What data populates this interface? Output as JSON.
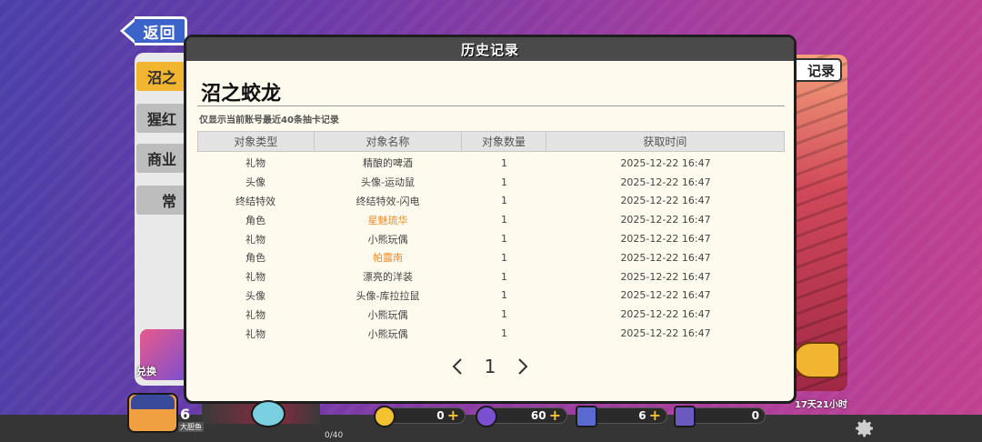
{
  "back_button": {
    "label": "返回"
  },
  "left_tabs": [
    {
      "label": "沼之",
      "active": true
    },
    {
      "label": "猩红",
      "active": false
    },
    {
      "label": "商业",
      "active": false
    },
    {
      "label": "常",
      "active": false
    }
  ],
  "left_promo": {
    "label": "兑换"
  },
  "right_panel": {
    "tag": "记录",
    "timer": "17天21小时"
  },
  "modal": {
    "header": "历史记录",
    "title": "沼之蛟龙",
    "note": "仅显示当前账号最近40条抽卡记录",
    "columns": [
      "对象类型",
      "对象名称",
      "对象数量",
      "获取时间"
    ],
    "rows": [
      {
        "type": "礼物",
        "name": "精酿的啤酒",
        "qty": "1",
        "time": "2025-12-22 16:47",
        "highlight": false
      },
      {
        "type": "头像",
        "name": "头像-运动鼠",
        "qty": "1",
        "time": "2025-12-22 16:47",
        "highlight": false
      },
      {
        "type": "终结特效",
        "name": "终结特效-闪电",
        "qty": "1",
        "time": "2025-12-22 16:47",
        "highlight": false
      },
      {
        "type": "角色",
        "name": "星魅琉华",
        "qty": "1",
        "time": "2025-12-22 16:47",
        "highlight": true
      },
      {
        "type": "礼物",
        "name": "小熊玩偶",
        "qty": "1",
        "time": "2025-12-22 16:47",
        "highlight": false
      },
      {
        "type": "角色",
        "name": "帕露南",
        "qty": "1",
        "time": "2025-12-22 16:47",
        "highlight": true
      },
      {
        "type": "礼物",
        "name": "漂亮的洋装",
        "qty": "1",
        "time": "2025-12-22 16:47",
        "highlight": false
      },
      {
        "type": "头像",
        "name": "头像-库拉拉鼠",
        "qty": "1",
        "time": "2025-12-22 16:47",
        "highlight": false
      },
      {
        "type": "礼物",
        "name": "小熊玩偶",
        "qty": "1",
        "time": "2025-12-22 16:47",
        "highlight": false
      },
      {
        "type": "礼物",
        "name": "小熊玩偶",
        "qty": "1",
        "time": "2025-12-22 16:47",
        "highlight": false
      }
    ],
    "pager": {
      "page": "1"
    },
    "highlight_color": "#f28c28"
  },
  "bottom_bar": {
    "level": "6",
    "level_label": "大胆鱼",
    "progress": "0/40",
    "resources": [
      {
        "name": "gold-coin",
        "value": "0",
        "color": "#f2c230"
      },
      {
        "name": "purple-gem",
        "value": "60",
        "color": "#7a4fd0"
      },
      {
        "name": "ticket",
        "value": "6",
        "color": "#5a6ad0"
      },
      {
        "name": "card-pack",
        "value": "0",
        "color": "#6a5ac0"
      }
    ]
  }
}
